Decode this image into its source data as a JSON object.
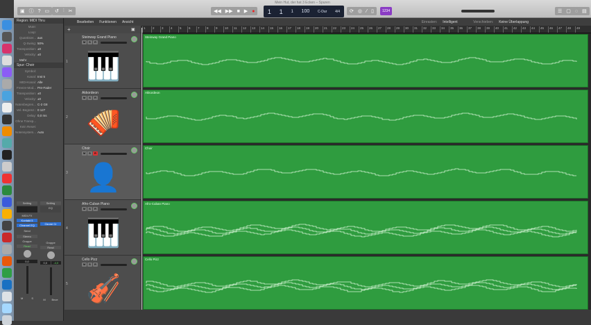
{
  "window": {
    "title": "Mein Hut, der hat 3 Ecken – Spuren"
  },
  "transport": {
    "bar": "1",
    "beat": "1",
    "div": "1",
    "tempo": "100",
    "key": "C-Dur",
    "signature": "4/4",
    "count_in": "1234"
  },
  "menu": {
    "items": [
      "Bearbeiten",
      "Funktionen",
      "Ansicht"
    ],
    "snap_label": "Einrasten:",
    "snap_value": "Intelligent",
    "move_label": "Verschieben:",
    "move_value": "Keine Überlappung"
  },
  "inspector": {
    "region_header": "Region: MIDI Thru",
    "region_rows": [
      {
        "k": "Mute:",
        "v": ""
      },
      {
        "k": "Loop:",
        "v": ""
      },
      {
        "k": "Quantisier...",
        "v": "aus"
      },
      {
        "k": "Q-Swing:",
        "v": "50%"
      },
      {
        "k": "Transposition:",
        "v": "±0"
      },
      {
        "k": "Velocity:",
        "v": "±0"
      }
    ],
    "more": "Mehr",
    "track_header": "Spur: Choir",
    "track_rows": [
      {
        "k": "Symbol:",
        "v": ""
      },
      {
        "k": "Kanal:",
        "v": "Inst 5"
      },
      {
        "k": "MIDI-Kanal:",
        "v": "Alle"
      },
      {
        "k": "Freeze-Mod...",
        "v": "Pre-Fader"
      },
      {
        "k": "Transposition:",
        "v": "±0"
      },
      {
        "k": "Velocity:",
        "v": "±0"
      },
      {
        "k": "Notenbegren...",
        "v": "C-2  G8"
      },
      {
        "k": "Vel.-Begrenz.:",
        "v": "0  127"
      },
      {
        "k": "Delay:",
        "v": "0,0 ms"
      },
      {
        "k": "Ohne Transp...",
        "v": ""
      },
      {
        "k": "Kein Reset:",
        "v": ""
      },
      {
        "k": "Notensystem...",
        "v": "Auto"
      }
    ],
    "strip1": {
      "setting": "Setting",
      "midifx": "MIDI-FX",
      "plugin1": "Kontakt 5",
      "plugin2": "Channel EQ",
      "send": "Send",
      "output": "Stereo",
      "group": "Gruppe",
      "auto": "Read",
      "vol": "0,0",
      "name_m": "M",
      "name_s": "S"
    },
    "strip2": {
      "setting": "Setting",
      "eq": "EQ",
      "plugin1": "Ozone Cr",
      "group": "Gruppe",
      "auto": "Read",
      "vol": "0,0",
      "pan": "-4,0",
      "name": "Bnce",
      "m": "M"
    }
  },
  "ruler": {
    "bars": [
      "1",
      "2",
      "3",
      "4",
      "5",
      "6",
      "7",
      "8",
      "9",
      "10",
      "11",
      "12",
      "13",
      "14",
      "15",
      "16",
      "17",
      "18",
      "19",
      "20",
      "21",
      "22",
      "23",
      "24",
      "25",
      "26",
      "27",
      "28",
      "29",
      "30",
      "31",
      "32",
      "33",
      "34",
      "35",
      "36",
      "37",
      "38",
      "39",
      "40",
      "41",
      "42",
      "43",
      "44",
      "45",
      "46",
      "47",
      "48",
      "49"
    ]
  },
  "tracks": [
    {
      "num": "1",
      "name": "Steinway Grand Piano",
      "icon": "🎹",
      "region": "Steinway Grand Piano"
    },
    {
      "num": "2",
      "name": "Akkordeon",
      "icon": "🪗",
      "region": "Akkordeon"
    },
    {
      "num": "3",
      "name": "Choir",
      "icon": "👤",
      "region": "Choir"
    },
    {
      "num": "4",
      "name": "Afro-Cuban Piano",
      "icon": "🎹",
      "region": "Afro-Cuban Piano"
    },
    {
      "num": "5",
      "name": "Cello Pizz",
      "icon": "🎻",
      "region": "Cello Pizz"
    }
  ],
  "track_buttons": {
    "m": "M",
    "s": "S",
    "r": "R"
  },
  "colors": {
    "region": "#2f9c3f",
    "accent_purple": "#8a3cc4",
    "lcd": "#1b2233"
  }
}
